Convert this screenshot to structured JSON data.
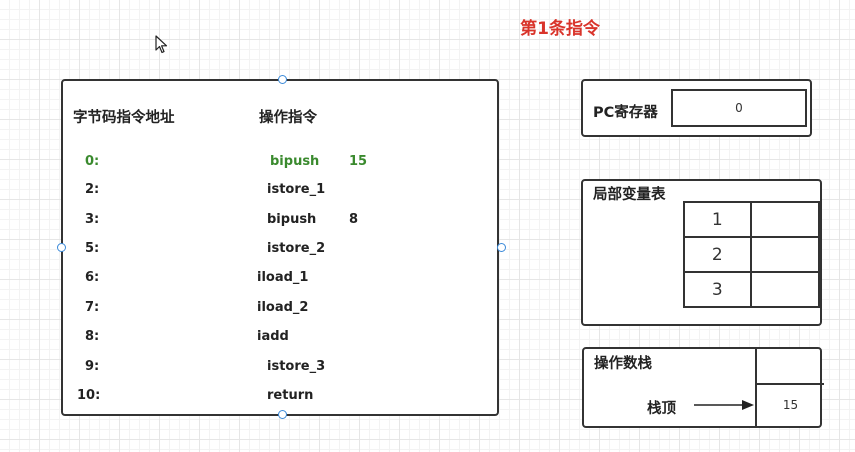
{
  "title": "第1条指令",
  "code_panel": {
    "header_address": "字节码指令地址",
    "header_instruction": "操作指令",
    "rows": [
      {
        "addr": "0:",
        "op": "bipush",
        "arg": "15",
        "active": true
      },
      {
        "addr": "2:",
        "op": "istore_1",
        "arg": "",
        "active": false
      },
      {
        "addr": "3:",
        "op": "bipush",
        "arg": "8",
        "active": false
      },
      {
        "addr": "5:",
        "op": "istore_2",
        "arg": "",
        "active": false
      },
      {
        "addr": "6:",
        "op": "iload_1",
        "arg": "",
        "active": false
      },
      {
        "addr": "7:",
        "op": "iload_2",
        "arg": "",
        "active": false
      },
      {
        "addr": "8:",
        "op": "iadd",
        "arg": "",
        "active": false
      },
      {
        "addr": "9:",
        "op": "istore_3",
        "arg": "",
        "active": false
      },
      {
        "addr": "10:",
        "op": "return",
        "arg": "",
        "active": false
      }
    ]
  },
  "pc_register": {
    "label": "PC寄存器",
    "value": "0"
  },
  "local_vars": {
    "label": "局部变量表",
    "slots": [
      {
        "index": "1",
        "value": ""
      },
      {
        "index": "2",
        "value": ""
      },
      {
        "index": "3",
        "value": ""
      }
    ]
  },
  "operand_stack": {
    "label": "操作数栈",
    "top_label": "栈顶",
    "cells": [
      "",
      "15"
    ]
  },
  "colors": {
    "title": "#d9342b",
    "active_instruction": "#3a8a2e",
    "handle": "#3b8ad9",
    "border": "#333333"
  }
}
